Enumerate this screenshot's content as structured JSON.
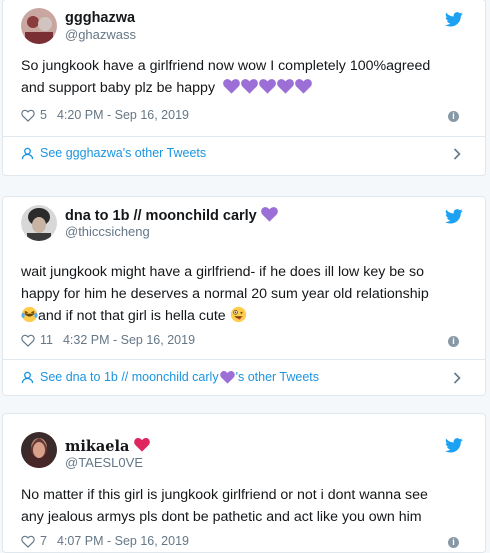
{
  "tweets": [
    {
      "display_name": "ggghazwa",
      "username": "@ghazwass",
      "text_line1": "So jungkook have a girlfriend now wow I completely 100%agreed",
      "text_line2": "and support baby plz be happy",
      "likes": "5",
      "timestamp": "4:20 PM - Sep 16, 2019",
      "see_more": "See ggghazwa's other Tweets"
    },
    {
      "display_name": "dna to 1b // moonchild carly",
      "username": "@thiccsicheng",
      "text_line1": "wait jungkook might have a girlfriend- if he does ill low key be so",
      "text_line2": "happy for him he deserves a normal 20 sum year old relationship",
      "text_line3": "and if not that girl is hella cute",
      "likes": "11",
      "timestamp": "4:32 PM - Sep 16, 2019",
      "see_more_prefix": "See dna to 1b // moonchild carly",
      "see_more_suffix": "'s other Tweets"
    },
    {
      "display_name": "mikaela",
      "username": "@TAESL0VE",
      "text_line1": "No matter if this girl is jungkook girlfriend or not i dont wanna see",
      "text_line2": "any jealous armys pls dont be pathetic and act like you own him",
      "likes": "7",
      "timestamp": "4:07 PM - Sep 16, 2019"
    }
  ],
  "icons": {
    "bird": "twitter-bird-icon",
    "heart": "heart-outline-icon",
    "info": "info-icon",
    "user": "user-icon",
    "chevron": "chevron-right-icon"
  },
  "colors": {
    "link": "#1b95e0",
    "twitter_blue": "#1da1f2",
    "purple_heart": "#9b6fd6",
    "red_heart": "#e0245e",
    "muted": "#657786"
  }
}
